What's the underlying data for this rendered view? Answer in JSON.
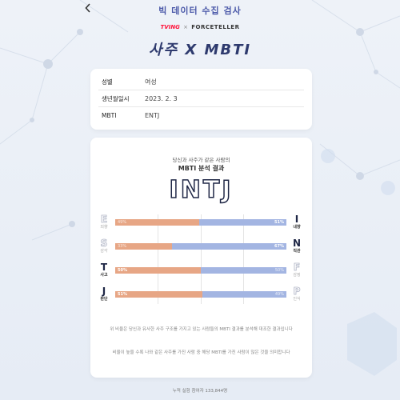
{
  "header": {
    "back_icon": "chevron-left-icon",
    "title": "빅 데이터 수집 검사"
  },
  "brands": {
    "left": "TVING",
    "sep": "×",
    "right": "FORCETELLER"
  },
  "hero": {
    "title": "사주 X MBTI"
  },
  "info": {
    "rows": [
      {
        "label": "성별",
        "value": "여성"
      },
      {
        "label": "생년월일시",
        "value": "2023. 2. 3"
      },
      {
        "label": "MBTI",
        "value": "ENTJ"
      }
    ]
  },
  "result": {
    "subtitle": "당신과 사주가 같은 사람의",
    "heading": "MBTI 분석 결과",
    "type": "INTJ",
    "dimensions": [
      {
        "left_letter": "E",
        "left_word": "외향",
        "right_letter": "I",
        "right_word": "내향",
        "left_pct": "49%",
        "right_pct": "51%",
        "left_value": 49,
        "right_value": 51,
        "dominant": "right"
      },
      {
        "left_letter": "S",
        "left_word": "감각",
        "right_letter": "N",
        "right_word": "직관",
        "left_pct": "33%",
        "right_pct": "67%",
        "left_value": 33,
        "right_value": 67,
        "dominant": "right"
      },
      {
        "left_letter": "T",
        "left_word": "사고",
        "right_letter": "F",
        "right_word": "감정",
        "left_pct": "50%",
        "right_pct": "50%",
        "left_value": 50,
        "right_value": 50,
        "dominant": "left"
      },
      {
        "left_letter": "J",
        "left_word": "판단",
        "right_letter": "P",
        "right_word": "인식",
        "left_pct": "51%",
        "right_pct": "49%",
        "left_value": 51,
        "right_value": 49,
        "dominant": "left"
      }
    ],
    "note1": "위 비율은 당신과 유사한 사주 구조를 가지고 있는 사람들의 MBTI 결과를 분석해 대조한 결과입니다",
    "note2": "비율이 높을 수록 나와 같은 사주를 가진 사람 중 해당 MBTI를 가진 사람이 많은 것을 의미합니다"
  },
  "footer": {
    "text": "누적 실험 참여자 133,844명"
  },
  "colors": {
    "left_bar": "#e7a685",
    "right_bar": "#a3b5e2",
    "accent": "#4a58a8"
  }
}
